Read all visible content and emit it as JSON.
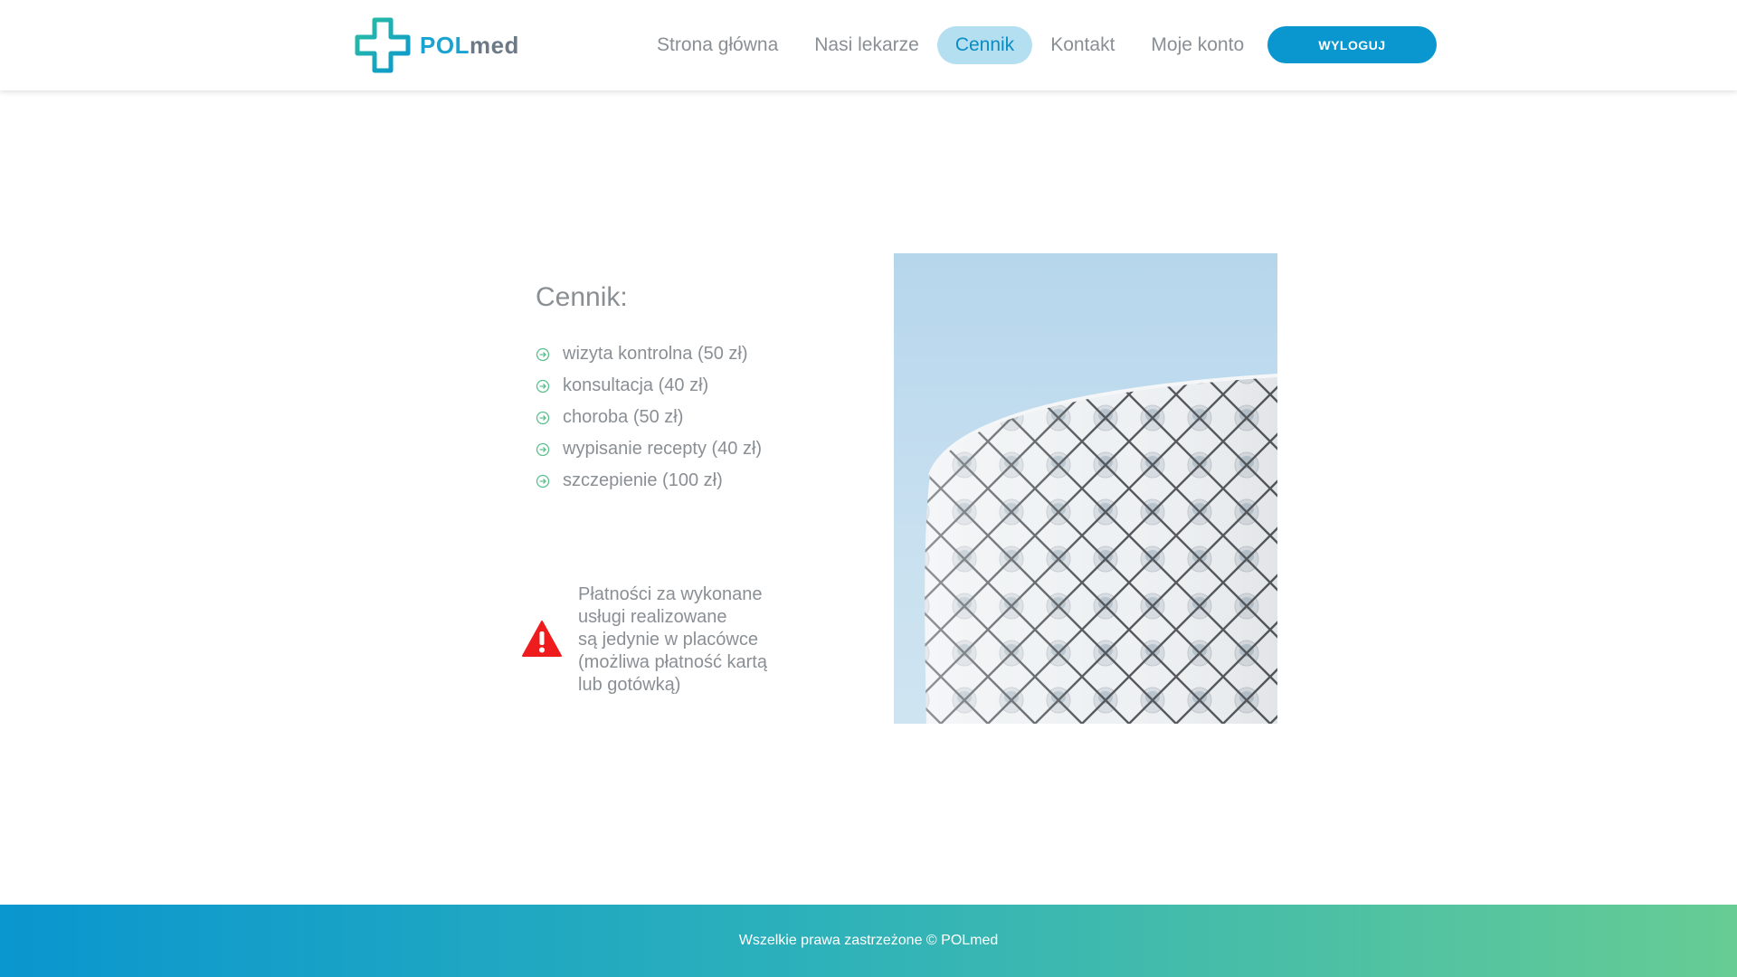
{
  "header": {
    "logo": {
      "text_pol": "POL",
      "text_med": "med"
    },
    "nav": [
      {
        "label": "Strona główna",
        "active": false
      },
      {
        "label": "Nasi lekarze",
        "active": false
      },
      {
        "label": "Cennik",
        "active": true
      },
      {
        "label": "Kontakt",
        "active": false
      },
      {
        "label": "Moje konto",
        "active": false
      }
    ],
    "logout_label": "WYLOGUJ"
  },
  "main": {
    "title": "Cennik:",
    "items": [
      "wizyta kontrolna (50 zł)",
      "konsultacja (40 zł)",
      "choroba (50 zł)",
      "wypisanie recepty (40 zł)",
      "szczepienie (100 zł)"
    ],
    "notice_lines": [
      "Płatności za wykonane",
      "usługi realizowane",
      "są jedynie w placówce",
      "(możliwa płatność kartą",
      "lub gotówką)"
    ],
    "bullet_icon": "arrow-circle-right-icon",
    "warning_icon": "warning-triangle-icon",
    "image": "building-facade-photo"
  },
  "footer": {
    "text": "Wszelkie prawa zastrzeżone © POLmed"
  },
  "colors": {
    "accent": "#0a96cf",
    "active_nav_bg": "#b3dff0",
    "text_gray": "#8a8f94",
    "bullet_green": "#5cc08e",
    "warning_red": "#ee1c1c",
    "footer_start": "#0a96cf",
    "footer_end": "#66cc94"
  }
}
